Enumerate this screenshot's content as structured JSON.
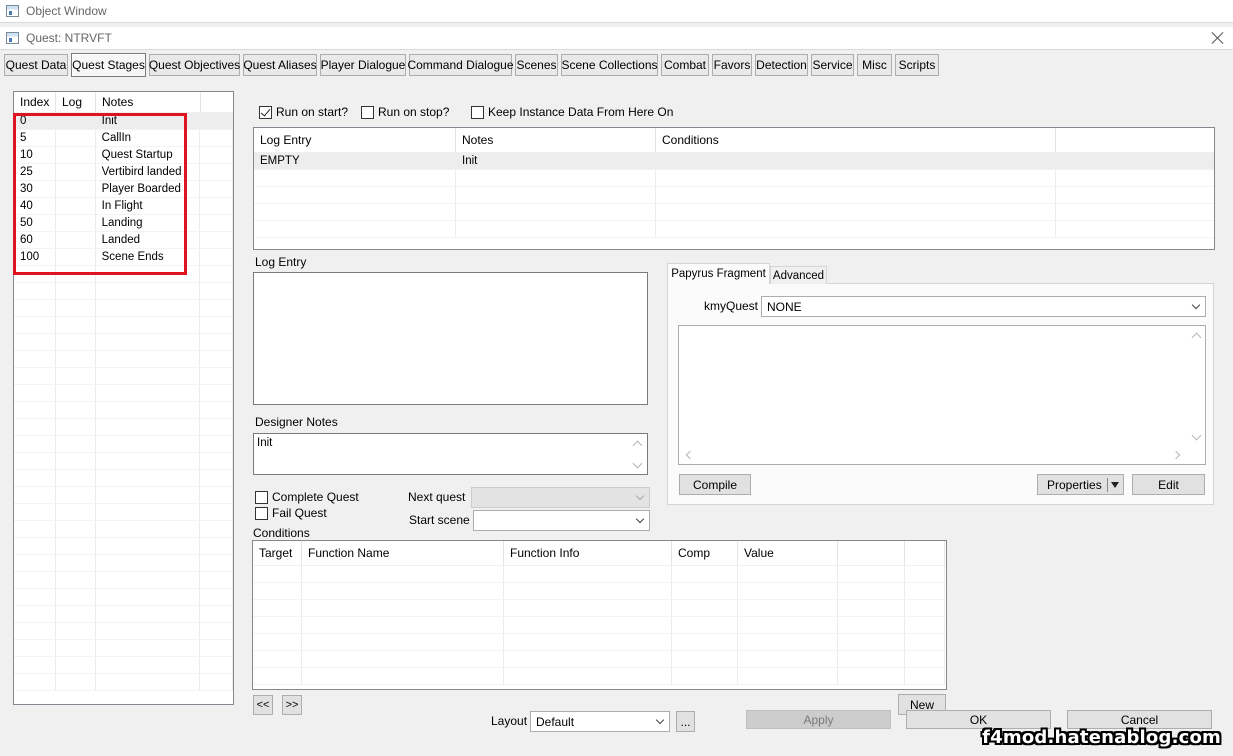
{
  "outer_window": {
    "title": "Object Window"
  },
  "window": {
    "title": "Quest: NTRVFT"
  },
  "tabs": [
    {
      "label": "Quest Data",
      "w": 64
    },
    {
      "label": "Quest Stages",
      "w": 75
    },
    {
      "label": "Quest Objectives",
      "w": 91
    },
    {
      "label": "Quest Aliases",
      "w": 74
    },
    {
      "label": "Player Dialogue",
      "w": 86
    },
    {
      "label": "Command Dialogue",
      "w": 103
    },
    {
      "label": "Scenes",
      "w": 43
    },
    {
      "label": "Scene Collections",
      "w": 97
    },
    {
      "label": "Combat",
      "w": 48
    },
    {
      "label": "Favors",
      "w": 40
    },
    {
      "label": "Detection",
      "w": 53
    },
    {
      "label": "Service",
      "w": 43
    },
    {
      "label": "Misc",
      "w": 35
    },
    {
      "label": "Scripts",
      "w": 44
    }
  ],
  "stages": {
    "headers": [
      "Index",
      "Log",
      "Notes"
    ],
    "rows": [
      {
        "index": "0",
        "log": "",
        "notes": "Init"
      },
      {
        "index": "5",
        "log": "",
        "notes": "CallIn"
      },
      {
        "index": "10",
        "log": "",
        "notes": "Quest Startup"
      },
      {
        "index": "25",
        "log": "",
        "notes": "Vertibird landed"
      },
      {
        "index": "30",
        "log": "",
        "notes": "Player Boarded"
      },
      {
        "index": "40",
        "log": "",
        "notes": "In Flight"
      },
      {
        "index": "50",
        "log": "",
        "notes": "Landing"
      },
      {
        "index": "60",
        "log": "",
        "notes": "Landed"
      },
      {
        "index": "100",
        "log": "",
        "notes": "Scene Ends"
      }
    ]
  },
  "stage_options": {
    "run_on_start": "Run on start?",
    "run_on_stop": "Run on stop?",
    "keep_instance": "Keep Instance Data From Here On"
  },
  "log_entries": {
    "headers": [
      "Log Entry",
      "Notes",
      "Conditions"
    ],
    "rows": [
      {
        "log_entry": "EMPTY",
        "notes": "Init",
        "conditions": ""
      }
    ]
  },
  "log_entry_label": "Log Entry",
  "designer_notes": {
    "label": "Designer Notes",
    "value": "Init"
  },
  "papyrus": {
    "tab_fragment": "Papyrus Fragment",
    "tab_advanced": "Advanced",
    "quest_label": "kmyQuest",
    "quest_value": "NONE",
    "compile": "Compile",
    "properties": "Properties",
    "edit": "Edit"
  },
  "complete_quest": "Complete Quest",
  "fail_quest": "Fail Quest",
  "next_quest_label": "Next quest",
  "start_scene_label": "Start scene",
  "conditions": {
    "label": "Conditions",
    "headers": [
      "Target",
      "Function Name",
      "Function Info",
      "Comp",
      "Value",
      "",
      ""
    ]
  },
  "nav_prev": "<<",
  "nav_next": ">>",
  "new_button": "New",
  "layout": {
    "label": "Layout",
    "value": "Default",
    "more": "..."
  },
  "buttons": {
    "apply": "Apply",
    "ok": "OK",
    "cancel": "Cancel"
  },
  "watermark": "f4mod.hatenablog.com"
}
